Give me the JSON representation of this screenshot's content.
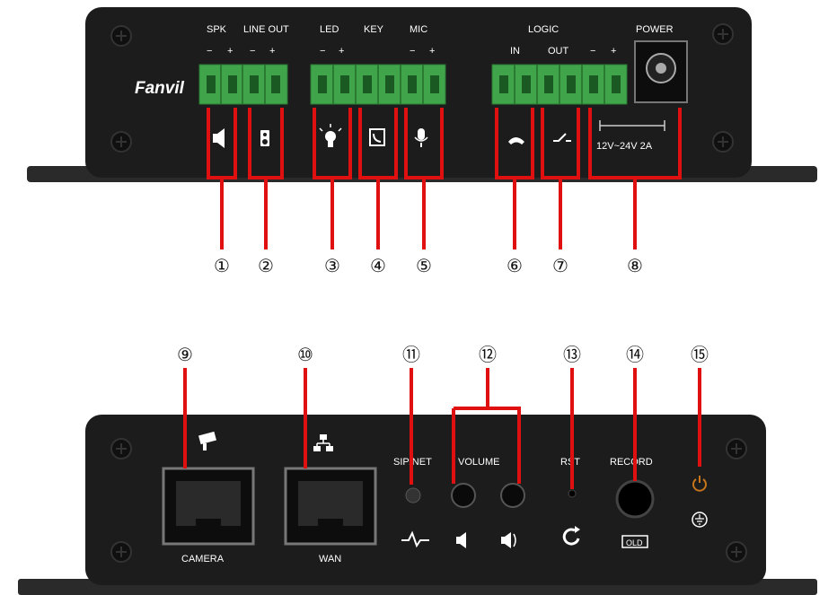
{
  "top_panel": {
    "brand": "Fanvil",
    "labels": {
      "spk": "SPK",
      "line_out": "LINE OUT",
      "led": "LED",
      "key": "KEY",
      "mic": "MIC",
      "logic": "LOGIC",
      "logic_in": "IN",
      "logic_out": "OUT",
      "power": "POWER",
      "power_spec": "12V~24V 2A"
    },
    "polarity": {
      "spk_minus": "−",
      "spk_plus": "+",
      "lo_minus": "−",
      "lo_plus": "+",
      "led_minus": "−",
      "led_plus": "+",
      "mic_minus": "−",
      "mic_plus": "+",
      "pw_minus": "−",
      "pw_plus": "+"
    },
    "callouts": [
      "①",
      "②",
      "③",
      "④",
      "⑤",
      "⑥",
      "⑦",
      "⑧"
    ]
  },
  "bottom_panel": {
    "labels": {
      "camera": "CAMERA",
      "wan": "WAN",
      "sipnet": "SIP/NET",
      "volume": "VOLUME",
      "rst": "RST",
      "record": "RECORD",
      "record_icon_text": "OLD"
    },
    "callouts": [
      "⑨",
      "⑩",
      "⑪",
      "⑫",
      "⑬",
      "⑭",
      "⑮"
    ]
  },
  "colors": {
    "device_body": "#1a1a1a",
    "terminal_green": "#3fa44a",
    "callout_line": "#e01010",
    "power_led": "#c8741a"
  },
  "icons": [
    "speaker-icon",
    "lineout-speaker-icon",
    "bulb-icon",
    "phone-key-icon",
    "microphone-icon",
    "handset-icon",
    "switch-icon",
    "camera-icon",
    "network-icon",
    "pulse-icon",
    "volume-down-icon",
    "volume-up-icon",
    "reset-arrow-icon",
    "ground-icon",
    "power-icon"
  ]
}
